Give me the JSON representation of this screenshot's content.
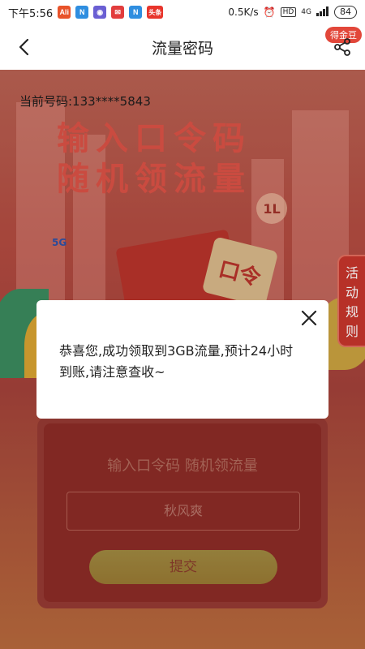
{
  "status_bar": {
    "time": "下午5:56",
    "net_speed": "0.5K/s",
    "hd": "HD",
    "network": "4G",
    "battery": "84",
    "app_icons": [
      "aliexpress-icon",
      "n-app-icon",
      "camera-app-icon",
      "sms-app-icon",
      "n-app-icon-2",
      "toutiao-icon"
    ],
    "toutiao_label": "头条"
  },
  "header": {
    "title": "流量密码",
    "gold_badge": "得金豆"
  },
  "content": {
    "phone_label": "当前号码:133****5843",
    "hero_line1": "输入口令码",
    "hero_line2": "随机领流量",
    "tag_1l": "1L",
    "tag_5g": "5G",
    "coupon_text": "口令",
    "rules_tab": [
      "活",
      "动",
      "规",
      "则"
    ],
    "form_heading": "输入口令码 随机领流量",
    "input_value": "秋风爽",
    "submit_label": "提交"
  },
  "dialog": {
    "message": "恭喜您,成功领取到3GB流量,预计24小时到账,请注意查收~"
  },
  "colors": {
    "accent_red": "#e2473a",
    "hero_text": "#dc5246",
    "card_bg": "#8d2c26"
  }
}
